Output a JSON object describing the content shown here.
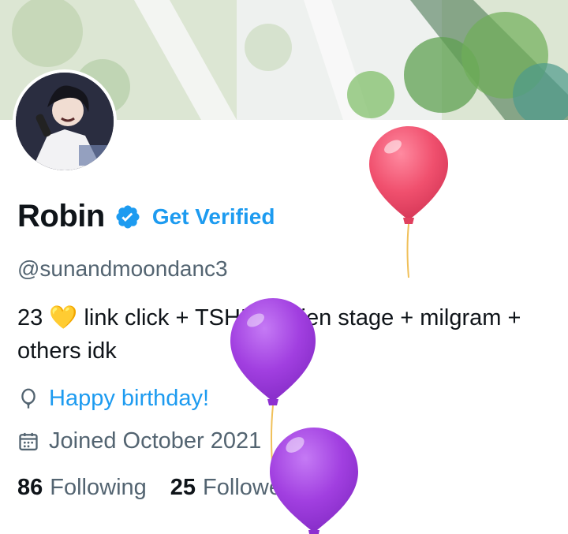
{
  "profile": {
    "display_name": "Robin",
    "get_verified_label": "Get Verified",
    "handle": "@sunandmoondanc3",
    "bio": "23 💛 link click + TSHD + alien stage + milgram + others idk",
    "birthday_text": "Happy birthday!",
    "joined_text": "Joined October 2021",
    "following_count": "86",
    "following_label": "Following",
    "followers_count": "25",
    "followers_label": "Followers"
  },
  "icons": {
    "verified": "verified-badge-icon",
    "birthday": "balloon-icon",
    "joined": "calendar-icon"
  },
  "colors": {
    "accent": "#1d9bf0",
    "secondary_text": "#536471",
    "primary_text": "#0f1419",
    "balloon_pink": "#f0506e",
    "balloon_purple": "#a13fe0"
  }
}
